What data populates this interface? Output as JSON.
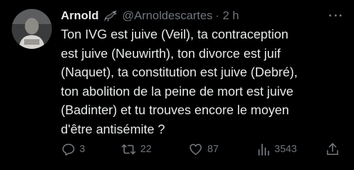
{
  "tweet": {
    "author_name": "Arnold",
    "handle": "@Arnoldescartes",
    "separator": "·",
    "time": "2 h",
    "text_lines": [
      "Ton IVG est juive (Veil), ta contraception",
      "est juive (Neuwirth), ton divorce est juif",
      "(Naquet), ta constitution est juive (Debré),",
      "ton abolition de la peine de mort est juive",
      "(Badinter) et tu trouves encore le moyen",
      "d'être antisémite ?"
    ]
  },
  "actions": {
    "replies": "3",
    "retweets": "22",
    "likes": "87",
    "views": "3543"
  },
  "icons": {
    "more": "more-horizontal-icon",
    "badge": "bird-emoji-badge",
    "reply": "reply-icon",
    "retweet": "retweet-icon",
    "like": "heart-icon",
    "views": "analytics-icon",
    "share": "share-icon"
  },
  "colors": {
    "background": "#000000",
    "text": "#e7e9ea",
    "muted": "#71767b"
  }
}
